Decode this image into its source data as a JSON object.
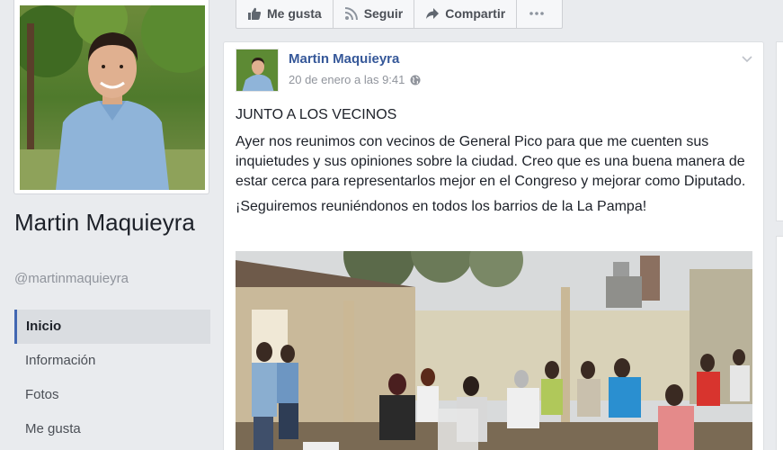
{
  "profile": {
    "name": "Martin Maquieyra",
    "handle": "@martinmaquieyra"
  },
  "nav": {
    "items": [
      {
        "label": "Inicio",
        "active": true
      },
      {
        "label": "Información",
        "active": false
      },
      {
        "label": "Fotos",
        "active": false
      },
      {
        "label": "Me gusta",
        "active": false
      }
    ]
  },
  "actions": {
    "like_label": "Me gusta",
    "follow_label": "Seguir",
    "share_label": "Compartir",
    "more_icon": "ellipsis-icon"
  },
  "post": {
    "author": "Martin Maquieyra",
    "timestamp": "20 de enero a las 9:41",
    "privacy_icon": "globe-icon",
    "heading": "JUNTO A LOS VECINOS",
    "body": "Ayer nos reunimos con vecinos de General Pico para que me cuenten sus inquietudes y sus opiniones sobre la ciudad. Creo que es una buena manera de estar cerca para representarlos mejor en el Congreso y mejorar como Diputado.",
    "closing": "¡Seguiremos reuniéndonos en todos los barrios de la La Pampa!"
  },
  "colors": {
    "brand_blue": "#4267b2",
    "link_blue": "#365899",
    "background": "#e9ebee"
  }
}
